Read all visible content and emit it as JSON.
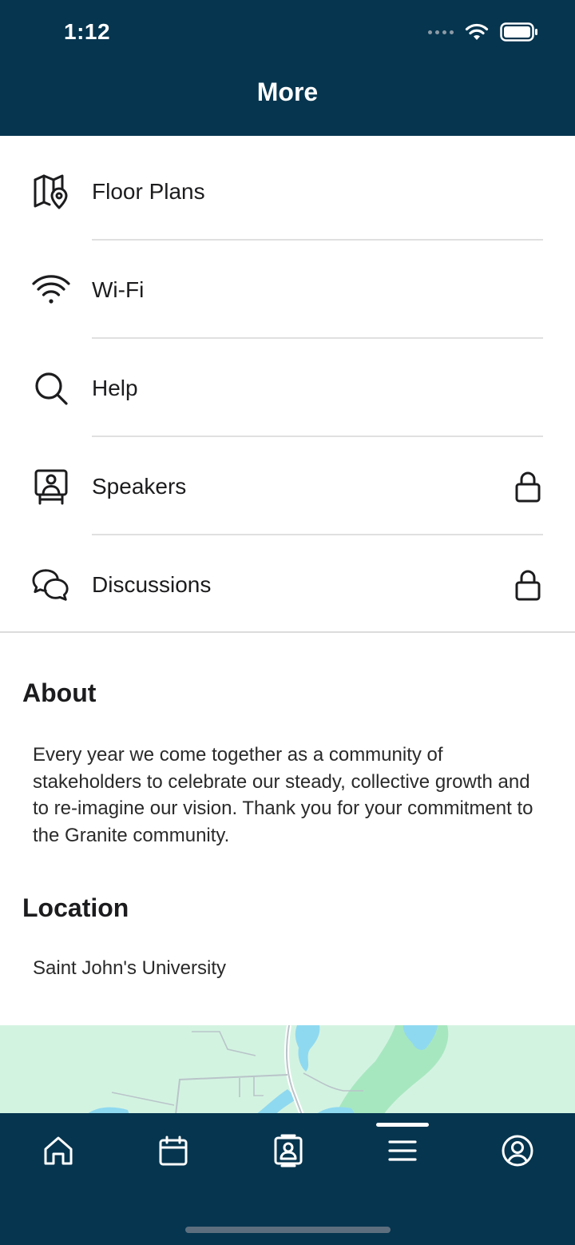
{
  "status_bar": {
    "time": "1:12"
  },
  "header": {
    "title": "More"
  },
  "menu": {
    "items": [
      {
        "label": "Floor Plans",
        "icon": "map-pin-icon",
        "locked": false
      },
      {
        "label": "Wi-Fi",
        "icon": "wifi-icon",
        "locked": false
      },
      {
        "label": "Help",
        "icon": "search-icon",
        "locked": false
      },
      {
        "label": "Speakers",
        "icon": "speaker-podium-icon",
        "locked": true
      },
      {
        "label": "Discussions",
        "icon": "chat-bubbles-icon",
        "locked": true
      }
    ]
  },
  "about": {
    "title": "About",
    "text": "Every year we come together as a community of stakeholders to celebrate our steady, collective growth and to re-imagine our vision. Thank you for your commitment to the Granite community."
  },
  "location": {
    "title": "Location",
    "text": "Saint John's University"
  },
  "tabbar": {
    "tabs": [
      {
        "icon": "home-icon",
        "active": false
      },
      {
        "icon": "calendar-icon",
        "active": false
      },
      {
        "icon": "contacts-icon",
        "active": false
      },
      {
        "icon": "menu-icon",
        "active": true
      },
      {
        "icon": "profile-icon",
        "active": false
      }
    ]
  },
  "colors": {
    "header_bg": "#06354f",
    "map_land": "#d3f3e1",
    "map_water": "#8fd9f0",
    "map_park": "#a7e7c0"
  }
}
